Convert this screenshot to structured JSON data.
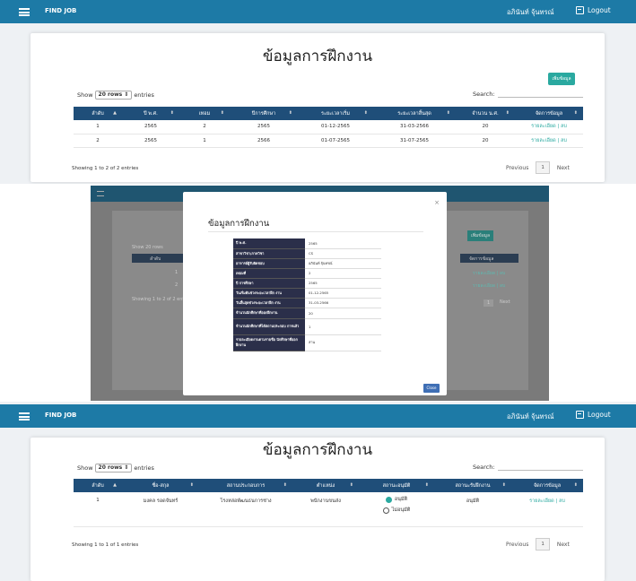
{
  "navbar": {
    "brand": "FIND JOB",
    "user": "อภินันท์ จุ้นทรณ์",
    "logout": "Logout"
  },
  "training": {
    "title": "ข้อมูลการฝึกงาน",
    "add_button": "เพิ่มข้อมูล",
    "show_prefix": "Show",
    "rows_select": "20 rows",
    "show_suffix": "entries",
    "search_label": "Search:",
    "columns": [
      "ลำดับ",
      "ปี พ.ศ.",
      "เทอม",
      "ปีการศึกษา",
      "ระยะเวลาเริ่ม",
      "ระยะเวลาสิ้นสุด",
      "จำนวน น.ศ.",
      "จัดการข้อมูล"
    ],
    "rows": [
      [
        "1",
        "2565",
        "2",
        "2565",
        "01-12-2565",
        "31-03-2566",
        "20",
        "รายละเอียด | ลบ"
      ],
      [
        "2",
        "2565",
        "1",
        "2566",
        "01-07-2565",
        "31-07-2565",
        "20",
        "รายละเอียด | ลบ"
      ]
    ],
    "info": "Showing 1 to 2 of 2 entries",
    "prev": "Previous",
    "page": "1",
    "next": "Next"
  },
  "modal": {
    "title": "ข้อมูลการฝึกงาน",
    "close_x": "×",
    "close_button": "Close",
    "rows": [
      {
        "label": "ปี พ.ศ.",
        "value": "2565"
      },
      {
        "label": "สาขาวิชา/ภาควิชา",
        "value": "CS"
      },
      {
        "label": "อาจารย์ผู้รับผิดชอบ",
        "value": "อภินันท์ จุ้นทรณ์"
      },
      {
        "label": "เทอมที่",
        "value": "2"
      },
      {
        "label": "ปี การศึกษา",
        "value": "2565"
      },
      {
        "label": "วันเริ่มต้นช่วงระยะเวลาฝึก งาน",
        "value": "01-12-2565"
      },
      {
        "label": "วันสิ้นสุดช่วงระยะเวลาฝึก งาน",
        "value": "31-03-2566"
      },
      {
        "label": "จำนวนนักศึกษาที่ออกฝึกงาน",
        "value": "20"
      },
      {
        "label": "จำนวนนักศึกษาที่ได้สถานประกอบ การแล้ว",
        "value": "1"
      },
      {
        "label": "รายละเอียดงานตามรายชื่อ นักศึกษาที่ออกฝึกงาน",
        "value": "ล่าน"
      }
    ]
  },
  "background_page": {
    "add_button": "เพิ่มข้อมูล",
    "show": "Show",
    "rows_select": "20 rows",
    "col_first": "ลำดับ",
    "col_last": "จัดการข้อมูล",
    "row_ids": [
      "1",
      "2"
    ],
    "row_action": "รายละเอียด | ลบ",
    "info": "Showing 1 to 2 of 2 entries",
    "page": "1",
    "next": "Next"
  },
  "students": {
    "title": "ข้อมูลการฝึกงาน",
    "show_prefix": "Show",
    "rows_select": "20 rows",
    "show_suffix": "entries",
    "search_label": "Search:",
    "columns": [
      "ลำดับ",
      "ชื่อ-สกุล",
      "สถานประกอบการ",
      "ตำแหน่ง",
      "สถานะอนุมัติ",
      "สถานะรับฝึกงาน",
      "จัดการข้อมูล"
    ],
    "row": {
      "no": "1",
      "name": "มงคล รอดจันทร์",
      "company": "โรงหล่อพัฒนธนการช่าง",
      "position": "พนักงานขนส่ง",
      "approve_option": "อนุมัติ",
      "reject_option": "ไม่อนุมัติ",
      "intern_status": "อนุมัติ",
      "action": "รายละเอียด | ลบ"
    },
    "info": "Showing 1 to 1 of 1 entries",
    "prev": "Previous",
    "page": "1",
    "next": "Next"
  }
}
